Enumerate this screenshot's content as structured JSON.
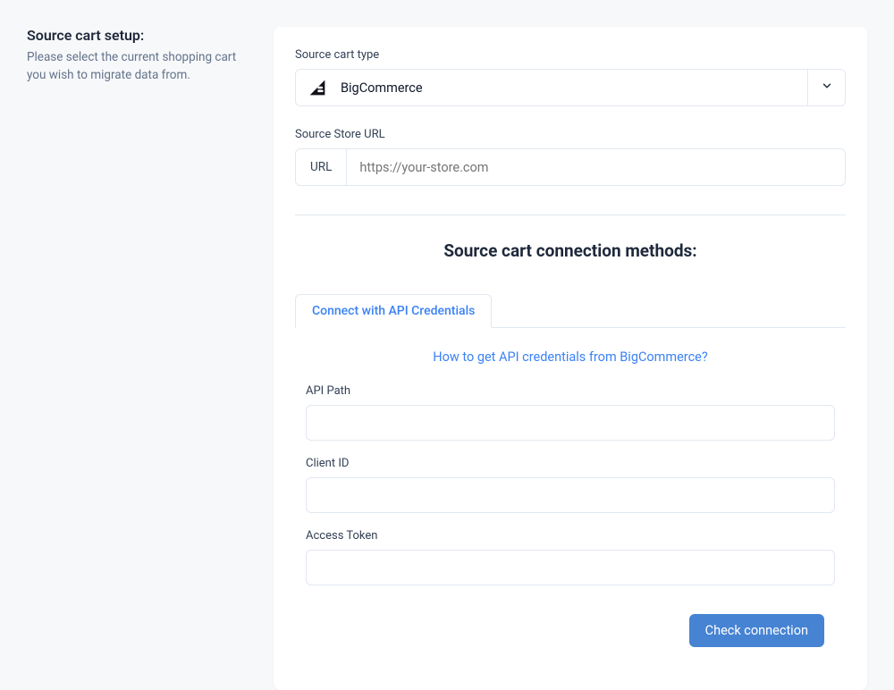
{
  "sidebar": {
    "title": "Source cart setup:",
    "description": "Please select the current shopping cart you wish to migrate data from."
  },
  "cartType": {
    "label": "Source cart type",
    "selected": "BigCommerce",
    "logo": "bigcommerce-logo"
  },
  "storeUrl": {
    "label": "Source Store URL",
    "prefix": "URL",
    "placeholder": "https://your-store.com",
    "value": ""
  },
  "connection": {
    "heading": "Source cart connection methods:",
    "tabs": [
      {
        "label": "Connect with API Credentials",
        "active": true
      }
    ],
    "help_link": "How to get API credentials from BigCommerce?",
    "fields": {
      "api_path": {
        "label": "API Path",
        "value": ""
      },
      "client_id": {
        "label": "Client ID",
        "value": ""
      },
      "access_token": {
        "label": "Access Token",
        "value": ""
      }
    },
    "check_button": "Check connection"
  }
}
